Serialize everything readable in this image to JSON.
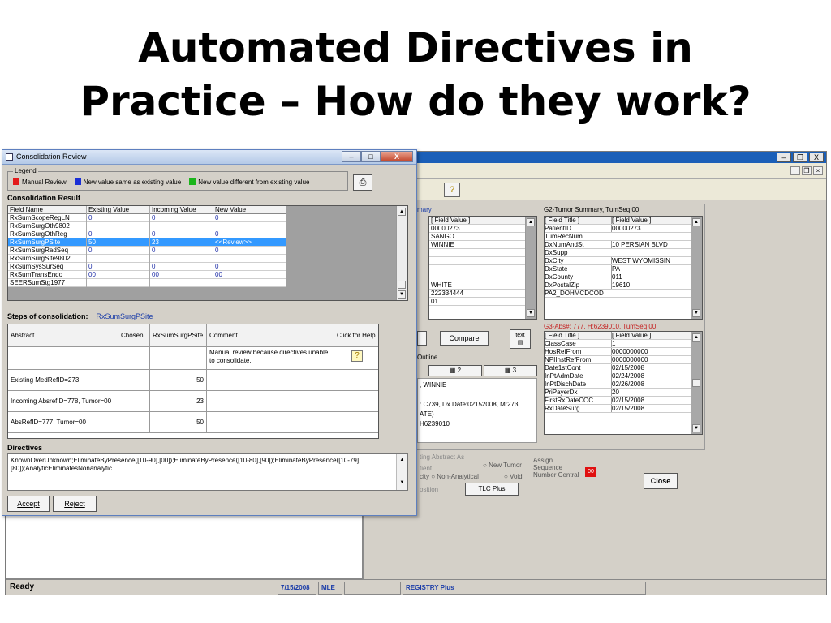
{
  "slide": {
    "title_line1": "Automated Directives in",
    "title_line2": "Practice – How do they work?"
  },
  "background_app": {
    "toolbar_help_icon": "help-icon",
    "g1": {
      "label": "mary",
      "header": "[ Field Value ]",
      "values": [
        "00000273",
        "SANGO",
        "WINNIE",
        "",
        "",
        "",
        "",
        "WHITE",
        "222334444",
        "01"
      ]
    },
    "g2": {
      "label": "G2-Tumor Summary, TumSeq:00",
      "header_title": "[ Field Title ]",
      "header_value": "[ Field Value ]",
      "rows": [
        [
          "PatientID",
          "00000273"
        ],
        [
          "TumRecNum",
          ""
        ],
        [
          "DxNumAndSt",
          "10 PERSIAN BLVD"
        ],
        [
          "DxSupp",
          ""
        ],
        [
          "DxCity",
          "WEST WYOMISSIN"
        ],
        [
          "DxState",
          "PA"
        ],
        [
          "DxCounty",
          "011"
        ],
        [
          "DxPostalZip",
          "19610"
        ],
        [
          "PA2_DOHMCDCOD",
          ""
        ]
      ]
    },
    "g3": {
      "label": "G3-Abs#: 777, H:6239010, TumSeq:00",
      "header_title": "[ Field Title ]",
      "header_value": "[ Field Value ]",
      "rows": [
        [
          "ClassCase",
          "1"
        ],
        [
          "HosRefFrom",
          "0000000000"
        ],
        [
          "NPIInstRefFrom",
          "0000000000"
        ],
        [
          "Date1stCont",
          "02/15/2008"
        ],
        [
          "InPtAdmDate",
          "02/24/2008"
        ],
        [
          "InPtDischDate",
          "02/26/2008"
        ],
        [
          "PriPayerDx",
          "20"
        ],
        [
          "FirstRxDateCOC",
          "02/15/2008"
        ],
        [
          "RxDateSurg",
          "02/15/2008"
        ]
      ]
    },
    "compare_label": "Compare",
    "text_btn_label": "text",
    "outline_label": "Outline",
    "tab2_label": "▦ 2",
    "tab3_label": "▦ 3",
    "outline_lines": [
      ", WINNIE",
      "",
      ": C739, Dx Date:02152008, M:273",
      "ATE)",
      "H6239010"
    ],
    "abstract_as_label": "ting Abstract As",
    "opt_tient": "tient",
    "opt_new_tumor": "New Tumor",
    "opt_city": "city",
    "opt_non_analytical": "Non-Analytical",
    "opt_void": "Void",
    "assign_seq_label": "Assign\nSequence\nNumber Central",
    "assign_seq_value": "00",
    "position_label": "osition",
    "tlc_plus_label": "TLC Plus",
    "close_label": "Close"
  },
  "status_bar": {
    "ready": "Ready",
    "date": "7/15/2008",
    "user": "MLE",
    "product": "REGISTRY Plus"
  },
  "consolidation_window": {
    "title": "Consolidation Review",
    "legend": {
      "title": "Legend",
      "items": [
        {
          "label": "Manual Review",
          "color": "#e31b1b"
        },
        {
          "label": "New value same as existing value",
          "color": "#1b2fd6"
        },
        {
          "label": "New value different from existing value",
          "color": "#1bb51b"
        }
      ]
    },
    "result_title": "Consolidation Result",
    "result_columns": [
      "Field Name",
      "Existing Value",
      "Incoming Value",
      "New Value"
    ],
    "result_rows": [
      [
        "RxSumScopeRegLN",
        "0",
        "0",
        "0"
      ],
      [
        "RxSumSurgOth9802",
        "",
        "",
        ""
      ],
      [
        "RxSumSurgOthReg",
        "0",
        "0",
        "0"
      ],
      [
        "RxSumSurgPSite",
        "50",
        "23",
        "<<Review>>"
      ],
      [
        "RxSumSurgRadSeq",
        "0",
        "0",
        "0"
      ],
      [
        "RxSumSurgSite9802",
        "",
        "",
        ""
      ],
      [
        "RxSumSysSurSeq",
        "0",
        "0",
        "0"
      ],
      [
        "RxSumTransEndo",
        "00",
        "00",
        "00"
      ],
      [
        "SEERSumStg1977",
        "",
        "",
        ""
      ]
    ],
    "steps_label": "Steps of consolidation:",
    "steps_field": "RxSumSurgPSite",
    "steps_columns": [
      "Abstract",
      "Chosen",
      "RxSumSurgPSite",
      "Comment",
      "Click for Help"
    ],
    "steps_rows": [
      {
        "abstract": "",
        "chosen": "",
        "value": "",
        "comment": "Manual review because directives unable to consolidate."
      },
      {
        "abstract": "Existing MedRefID=273",
        "chosen": "",
        "value": "50",
        "comment": ""
      },
      {
        "abstract": "Incoming AbsrefID=778, Tumor=00",
        "chosen": "",
        "value": "23",
        "comment": ""
      },
      {
        "abstract": "AbsRefID=777, Tumor=00",
        "chosen": "",
        "value": "50",
        "comment": ""
      }
    ],
    "directives_label": "Directives",
    "directives_text": "KnownOverUnknown;EliminateByPresence([10-90],[00]);EliminateByPresence([10-80],[90]);EliminateByPresence([10-79],[80]);AnalyticEliminatesNonanalytic",
    "accept_label": "Accept",
    "reject_label": "Reject"
  }
}
